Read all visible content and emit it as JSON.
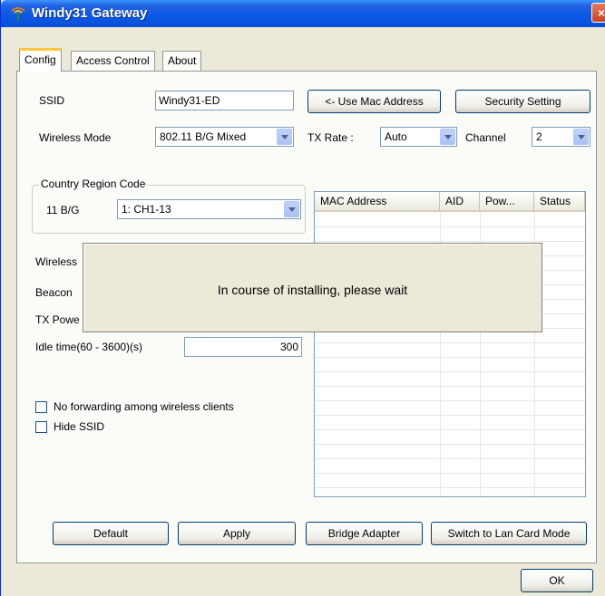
{
  "window": {
    "title": "Windy31 Gateway",
    "close_glyph": "×",
    "icon": "antenna-icon"
  },
  "tabs": [
    {
      "label": "Config",
      "active": true
    },
    {
      "label": "Access Control",
      "active": false
    },
    {
      "label": "About",
      "active": false
    }
  ],
  "config": {
    "ssid_label": "SSID",
    "ssid_value": "Windy31-ED",
    "use_mac_button": "<- Use Mac Address",
    "security_button": "Security Setting",
    "wireless_mode_label": "Wireless Mode",
    "wireless_mode_value": "802.11 B/G Mixed",
    "tx_rate_label": "TX Rate :",
    "tx_rate_value": "Auto",
    "channel_label": "Channel",
    "channel_value": "2",
    "country_group_label": "Country Region Code",
    "band_label": "11 B/G",
    "region_value": "1: CH1-13",
    "wireless_partial_label": "Wireless",
    "beacon_partial_label": "Beacon",
    "tx_power_partial_label": "TX Powe",
    "idle_label": "Idle time(60 - 3600)(s)",
    "idle_value": "300",
    "no_forwarding_label": "No forwarding among wireless clients",
    "no_forwarding_checked": false,
    "hide_ssid_label": "Hide SSID",
    "hide_ssid_checked": false
  },
  "client_table": {
    "columns": [
      "MAC Address",
      "AID",
      "Pow...",
      "Status"
    ],
    "rows": []
  },
  "popup": {
    "message": "In course of installing, please wait"
  },
  "buttons": {
    "default": "Default",
    "apply": "Apply",
    "bridge": "Bridge Adapter",
    "switch_mode": "Switch to Lan Card Mode",
    "ok": "OK"
  },
  "colors": {
    "titlebar": "#0a58e6",
    "dialog_bg": "#ECE9D8",
    "tab_highlight": "#ffc83c"
  }
}
